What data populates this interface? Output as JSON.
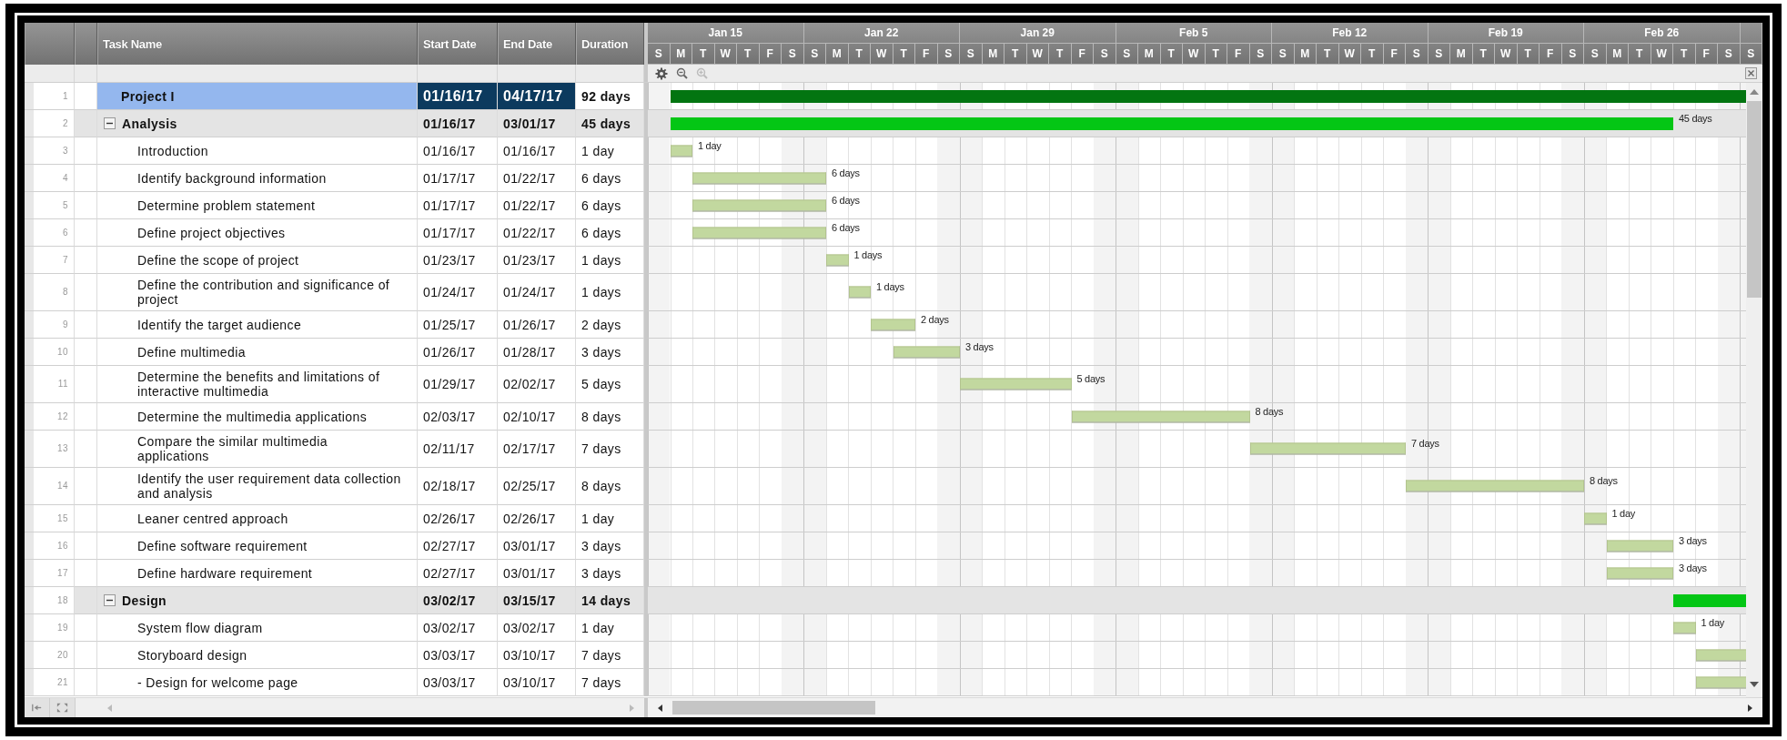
{
  "columns": [
    "Task Name",
    "Start Date",
    "End Date",
    "Duration"
  ],
  "timeline": {
    "weeks": [
      {
        "label": "Jan 15",
        "days": [
          "S",
          "M",
          "T",
          "W",
          "T",
          "F",
          "S"
        ]
      },
      {
        "label": "Jan 22",
        "days": [
          "S",
          "M",
          "T",
          "W",
          "T",
          "F",
          "S"
        ]
      },
      {
        "label": "Jan 29",
        "days": [
          "S",
          "M",
          "T",
          "W",
          "T",
          "F",
          "S"
        ]
      },
      {
        "label": "Feb 5",
        "days": [
          "S",
          "M",
          "T",
          "W",
          "T",
          "F",
          "S"
        ]
      },
      {
        "label": "Feb 12",
        "days": [
          "S",
          "M",
          "T",
          "W",
          "T",
          "F",
          "S"
        ]
      },
      {
        "label": "Feb 19",
        "days": [
          "S",
          "M",
          "T",
          "W",
          "T",
          "F",
          "S"
        ]
      },
      {
        "label": "Feb 26",
        "days": [
          "S",
          "M",
          "T",
          "W",
          "T",
          "F",
          "S"
        ]
      },
      {
        "days": [
          "S"
        ]
      }
    ]
  },
  "rows": [
    {
      "num": "1",
      "kind": "project",
      "name": "Project I",
      "start": "01/16/17",
      "end": "04/17/17",
      "duration": "92 days",
      "selected": true
    },
    {
      "num": "2",
      "kind": "summary",
      "name": "Analysis",
      "start": "01/16/17",
      "end": "03/01/17",
      "duration": "45 days",
      "bar_label": "45 days",
      "expanded": true,
      "selected": false,
      "children": [
        {
          "num": "3",
          "kind": "task",
          "name": "Introduction",
          "start": "01/16/17",
          "end": "01/16/17",
          "duration": "1 day",
          "bar_label": "1 day",
          "selected": false
        },
        {
          "num": "4",
          "kind": "task",
          "name": "Identify background information",
          "start": "01/17/17",
          "end": "01/22/17",
          "duration": "6 days",
          "bar_label": "6 days",
          "selected": false
        },
        {
          "num": "5",
          "kind": "task",
          "name": "Determine problem statement",
          "start": "01/17/17",
          "end": "01/22/17",
          "duration": "6 days",
          "bar_label": "6 days",
          "selected": false
        },
        {
          "num": "6",
          "kind": "task",
          "name": "Define project objectives",
          "start": "01/17/17",
          "end": "01/22/17",
          "duration": "6 days",
          "bar_label": "6 days",
          "selected": false
        },
        {
          "num": "7",
          "kind": "task",
          "name": "Define the scope of project",
          "start": "01/23/17",
          "end": "01/23/17",
          "duration": "1 days",
          "bar_label": "1 days",
          "selected": false
        },
        {
          "num": "8",
          "kind": "task",
          "name": "Define the contribution and significance of project",
          "start": "01/24/17",
          "end": "01/24/17",
          "duration": "1 days",
          "bar_label": "1 days",
          "selected": false
        },
        {
          "num": "9",
          "kind": "task",
          "name": "Identify the target audience",
          "start": "01/25/17",
          "end": "01/26/17",
          "duration": "2 days",
          "bar_label": "2 days",
          "selected": false
        },
        {
          "num": "10",
          "kind": "task",
          "name": "Define multimedia",
          "start": "01/26/17",
          "end": "01/28/17",
          "duration": "3 days",
          "bar_label": "3 days",
          "selected": false
        },
        {
          "num": "11",
          "kind": "task",
          "name": "Determine the benefits and limitations of interactive multimedia",
          "start": "01/29/17",
          "end": "02/02/17",
          "duration": "5 days",
          "bar_label": "5 days",
          "selected": false
        },
        {
          "num": "12",
          "kind": "task",
          "name": "Determine the multimedia applications",
          "start": "02/03/17",
          "end": "02/10/17",
          "duration": "8 days",
          "bar_label": "8 days",
          "selected": false
        },
        {
          "num": "13",
          "kind": "task",
          "name": "Compare the similar multimedia applications",
          "start": "02/11/17",
          "end": "02/17/17",
          "duration": "7 days",
          "bar_label": "7 days",
          "selected": false
        },
        {
          "num": "14",
          "kind": "task",
          "name": "Identify the user requirement data collection and analysis",
          "start": "02/18/17",
          "end": "02/25/17",
          "duration": "8 days",
          "bar_label": "8 days",
          "selected": false
        },
        {
          "num": "15",
          "kind": "task",
          "name": "Leaner centred approach",
          "start": "02/26/17",
          "end": "02/26/17",
          "duration": "1 day",
          "bar_label": "1 day",
          "selected": false
        },
        {
          "num": "16",
          "kind": "task",
          "name": "Define software requirement",
          "start": "02/27/17",
          "end": "03/01/17",
          "duration": "3 days",
          "bar_label": "3 days",
          "selected": false
        },
        {
          "num": "17",
          "kind": "task",
          "name": "Define hardware requirement",
          "start": "02/27/17",
          "end": "03/01/17",
          "duration": "3 days",
          "bar_label": "3 days",
          "selected": false
        }
      ]
    },
    {
      "num": "18",
      "kind": "summary",
      "name": "Design",
      "start": "03/02/17",
      "end": "03/15/17",
      "duration": "14 days",
      "expanded": true,
      "selected": false,
      "children": [
        {
          "num": "19",
          "kind": "task",
          "name": "System flow diagram",
          "start": "03/02/17",
          "end": "03/02/17",
          "duration": "1 day",
          "bar_label": "1 day",
          "selected": false
        },
        {
          "num": "20",
          "kind": "task",
          "name": "Storyboard design",
          "start": "03/03/17",
          "end": "03/10/17",
          "duration": "7 days",
          "selected": false
        },
        {
          "num": "21",
          "kind": "task",
          "name": "- Design for welcome page",
          "start": "03/03/17",
          "end": "03/10/17",
          "duration": "7 days",
          "selected": false
        }
      ]
    }
  ]
}
